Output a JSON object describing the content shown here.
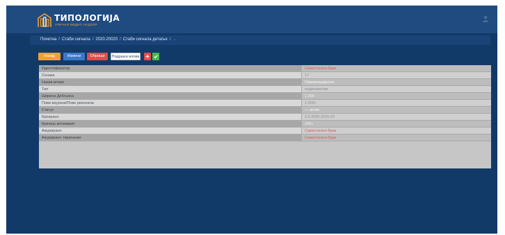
{
  "app": {
    "title": "ТИПОЛОГИЈА",
    "subtitle": "УЛИЧНИ ВИДЕО НАДЗОР",
    "colors": {
      "background": "#123a68",
      "header": "#1f4b80",
      "accent": "#f2a233"
    }
  },
  "breadcrumb": {
    "items": [
      "Почетна",
      "Стаби сигнала",
      "2020.20020",
      "Стаби сигнала детаље"
    ],
    "current": "..."
  },
  "toolbar": {
    "back_label": "Назад",
    "edit_label": "Измени",
    "delete_label": "Обриши",
    "card_label": "Подршка влова",
    "add_icon": "plus-icon",
    "ok_icon": "check-icon"
  },
  "details": {
    "rows": [
      {
        "label": "Идентификатор",
        "value": "Самостално-брак"
      },
      {
        "label": "Ознака",
        "value": "17"
      },
      {
        "label": "Назив влове",
        "value": "Првемпедијалне"
      },
      {
        "label": "Тип",
        "value": "подвоминтив"
      },
      {
        "label": "Ширина Дебљина",
        "value": "1.000"
      },
      {
        "label": "Пови вкурани/Пове реконала",
        "value": "1.000+"
      },
      {
        "label": "Статус",
        "value": "— актив"
      },
      {
        "label": "Креирано",
        "value": "2.0.2020.2020.20"
      },
      {
        "label": "Кринеш аплиакаит",
        "value": "100+"
      },
      {
        "label": "Ажурирано",
        "value": "Самостално-брак"
      },
      {
        "label": "Ажурирано тирачание",
        "value": "Самостално-брак"
      }
    ]
  }
}
